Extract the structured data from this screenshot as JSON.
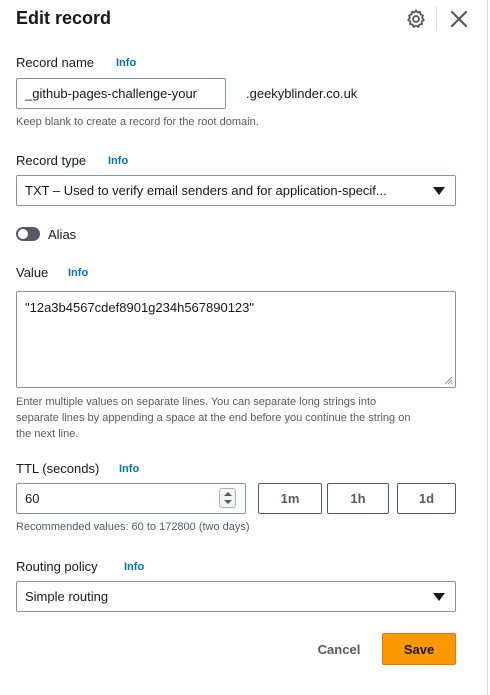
{
  "header": {
    "title": "Edit record"
  },
  "record_name": {
    "label": "Record name",
    "info": "Info",
    "value": "_github-pages-challenge-your",
    "suffix": ".geekyblinder.co.uk",
    "hint": "Keep blank to create a record for the root domain."
  },
  "record_type": {
    "label": "Record type",
    "info": "Info",
    "selected": "TXT – Used to verify email senders and for application-specif..."
  },
  "alias": {
    "label": "Alias",
    "enabled": false
  },
  "value": {
    "label": "Value",
    "info": "Info",
    "text": "\"12a3b4567cdef8901g234h567890123\"",
    "hint_lines": [
      "Enter multiple values on separate lines. You can separate long strings into",
      "separate lines by appending a space at the end before you continue the string on",
      "the next line."
    ]
  },
  "ttl": {
    "label": "TTL (seconds)",
    "info": "Info",
    "value": "60",
    "buttons": [
      "1m",
      "1h",
      "1d"
    ],
    "hint": "Recommended values: 60 to 172800 (two days)"
  },
  "routing_policy": {
    "label": "Routing policy",
    "info": "Info",
    "selected": "Simple routing"
  },
  "footer": {
    "cancel_label": "Cancel",
    "save_label": "Save"
  },
  "colors": {
    "primary_button": "#ff9900",
    "link": "#0073bb",
    "text": "#16191f",
    "border": "#879596"
  },
  "icons": {
    "settings": "gear-icon",
    "close": "close-icon",
    "dropdown": "caret-down-icon"
  }
}
